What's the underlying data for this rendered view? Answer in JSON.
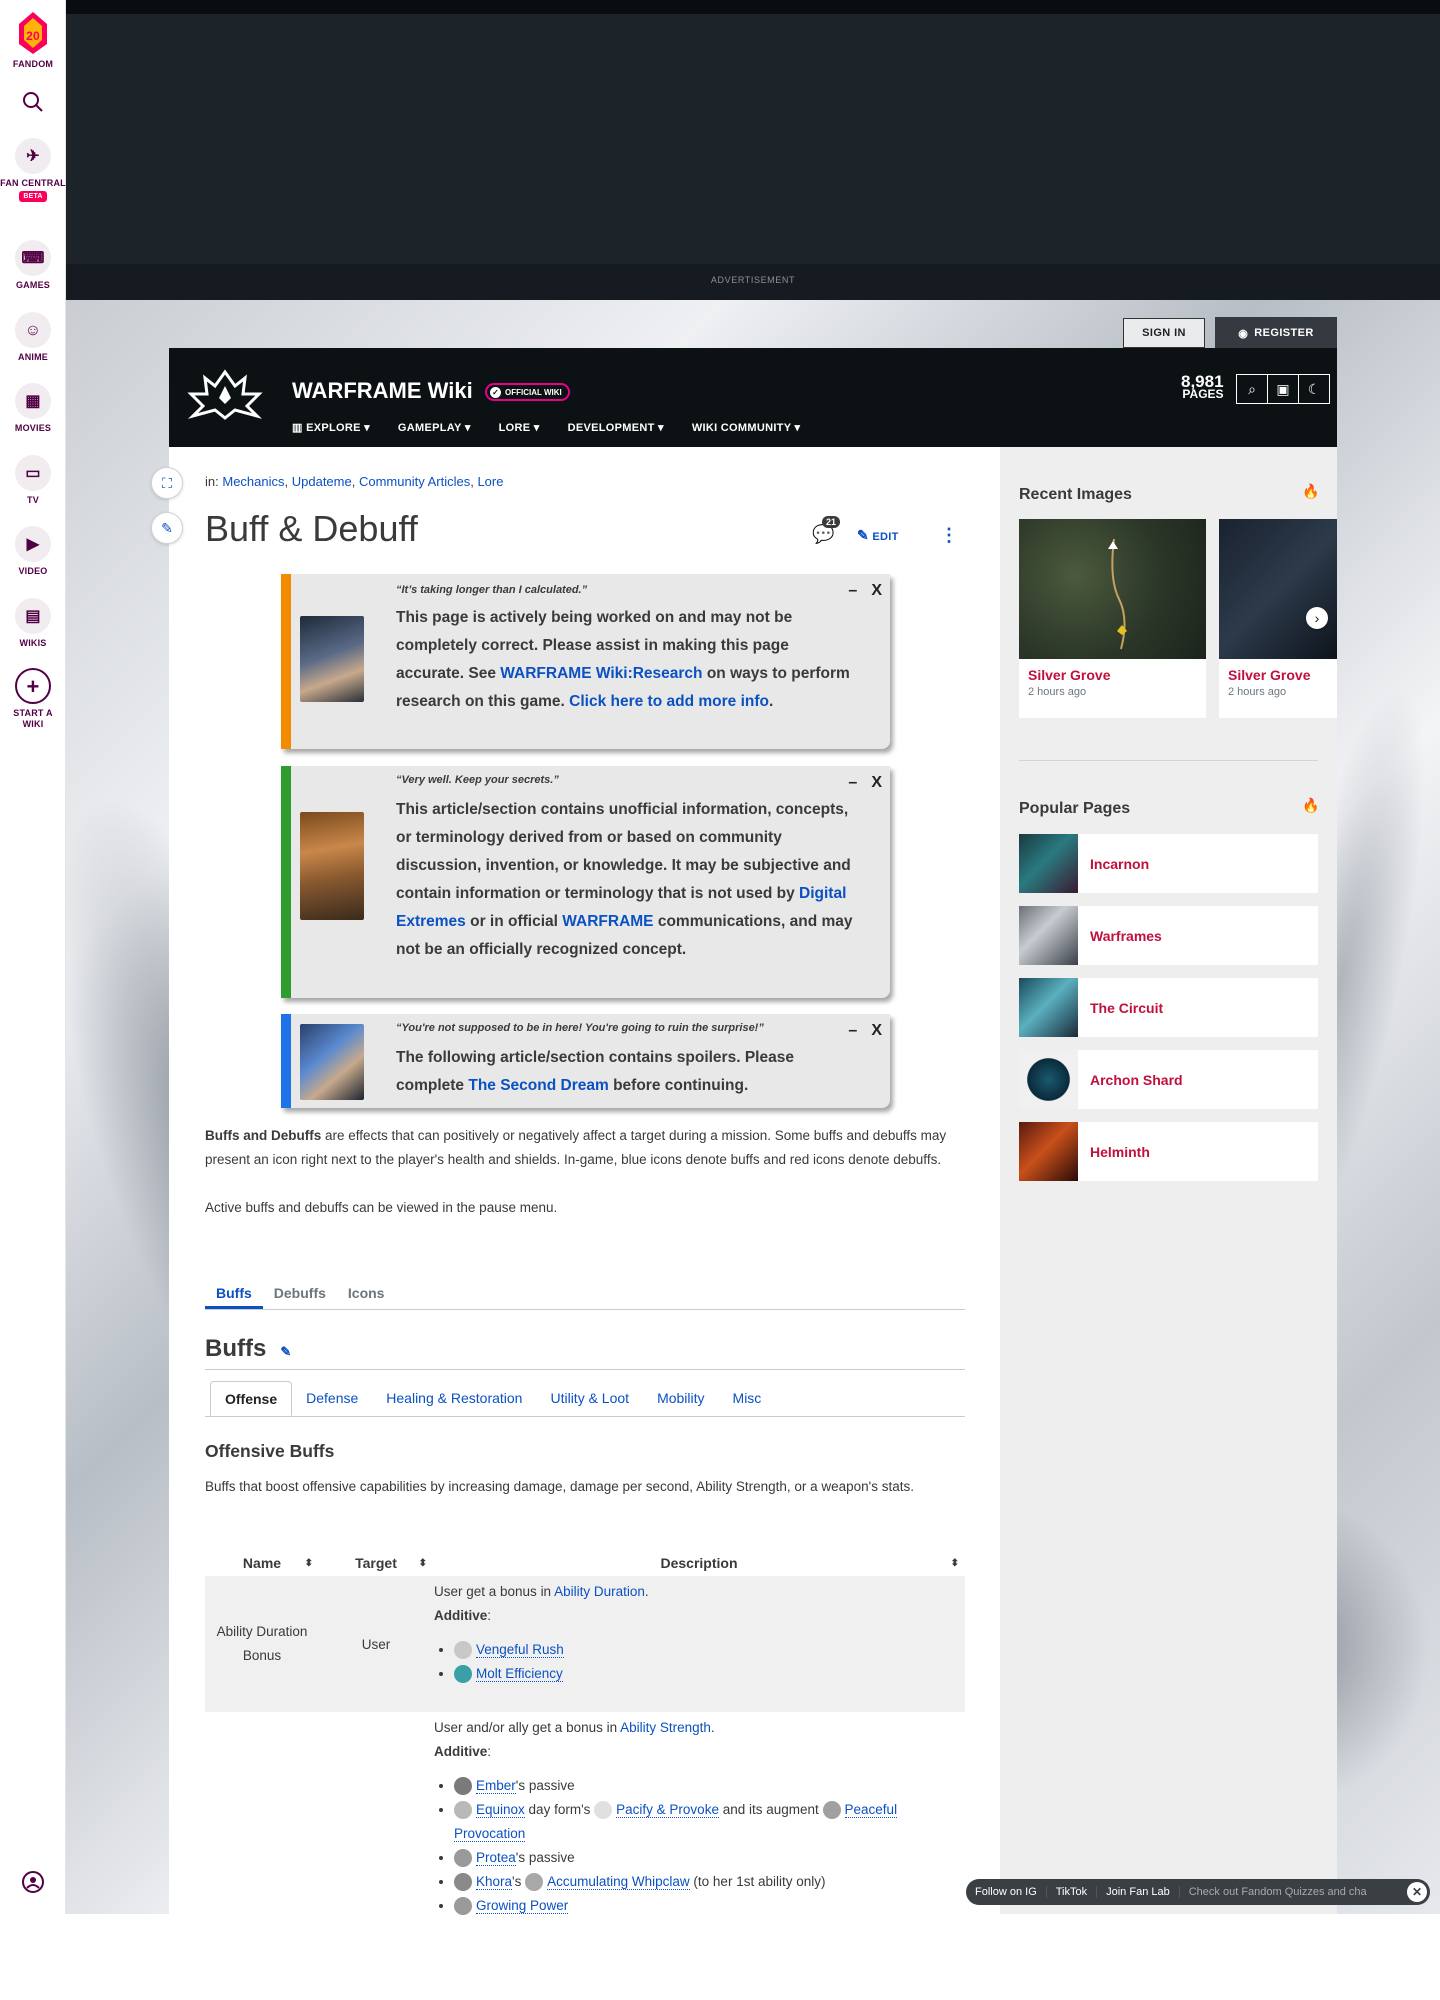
{
  "rail": {
    "fandom_badge": "20",
    "fandom": "FANDOM",
    "fan_central": "FAN CENTRAL",
    "beta": "BETA",
    "games": "GAMES",
    "anime": "ANIME",
    "movies": "MOVIES",
    "tv": "TV",
    "video": "VIDEO",
    "wikis": "WIKIS",
    "start_wiki": "START A WIKI"
  },
  "ad": {
    "label": "ADVERTISEMENT"
  },
  "auth": {
    "signin": "SIGN IN",
    "register": "REGISTER"
  },
  "wiki": {
    "title": "WARFRAME Wiki",
    "official": "OFFICIAL WIKI",
    "nav": [
      "EXPLORE",
      "GAMEPLAY",
      "LORE",
      "DEVELOPMENT",
      "WIKI COMMUNITY"
    ],
    "pages_count": "8,981",
    "pages_label": "PAGES"
  },
  "article": {
    "cats_prefix": "in:",
    "categories": [
      "Mechanics",
      "Updateme",
      "Community Articles",
      "Lore"
    ],
    "title": "Buff & Debuff",
    "comments": "21",
    "edit": "EDIT"
  },
  "notices": [
    {
      "quote": "“It’s taking longer than I calculated.”",
      "text1": "This page is actively being worked on and may not be completely correct. Please assist in making this page accurate. See ",
      "link1": "WARFRAME Wiki:Research",
      "text2": " on ways to perform research on this game. ",
      "link2": "Click here to add more info",
      "text3": ".",
      "color": "#f28b00"
    },
    {
      "quote": "“Very well. Keep your secrets.”",
      "text1": "This article/section contains unofficial information, concepts, or terminology derived from or based on community discussion, invention, or knowledge. It may be subjective and contain information or terminology that is not used by ",
      "link1": "Digital Extremes",
      "text2": " or in official ",
      "link2": "WARFRAME",
      "text3": " communications, and may not be an officially recognized concept.",
      "color": "#2e9c2e"
    },
    {
      "quote": "“You're not supposed to be in here! You're going to ruin the surprise!”",
      "text1": "The following article/section contains spoilers. Please complete ",
      "link1": "The Second Dream",
      "text2": " before continuing.",
      "color": "#1e73e8"
    }
  ],
  "intro": {
    "bold": "Buffs and Debuffs",
    "p1": " are effects that can positively or negatively affect a target during a mission. Some buffs and debuffs may present an icon right next to the player's health and shields. In-game, blue icons denote buffs and red icons denote debuffs.",
    "p2": "Active buffs and debuffs can be viewed in the pause menu."
  },
  "tabs": [
    "Buffs",
    "Debuffs",
    "Icons"
  ],
  "section_title": "Buffs",
  "subtabs": [
    "Offense",
    "Defense",
    "Healing & Restoration",
    "Utility & Loot",
    "Mobility",
    "Misc"
  ],
  "sub_title": "Offensive Buffs",
  "sub_desc": "Buffs that boost offensive capabilities by increasing damage, damage per second, Ability Strength, or a weapon's stats.",
  "table": {
    "headers": [
      "Name",
      "Target",
      "Description"
    ],
    "row1": {
      "name": "Ability Duration Bonus",
      "target": "User",
      "desc_pre": "User get a bonus in ",
      "desc_link": "Ability Duration",
      "desc_post": ".",
      "additive": "Additive",
      "items": [
        "Vengeful Rush",
        "Molt Efficiency"
      ]
    },
    "row2": {
      "desc_pre": "User and/or ally get a bonus in ",
      "desc_link": "Ability Strength",
      "desc_post": ".",
      "additive": "Additive",
      "i1_link": "Ember",
      "i1_text": "'s passive",
      "i2_link": "Equinox",
      "i2_text": " day form's ",
      "i2_link2": "Pacify & Provoke",
      "i2_text2": " and its augment ",
      "i2_link3": "Peaceful Provocation",
      "i3_link": "Protea",
      "i3_text": "'s passive",
      "i4_link": "Khora",
      "i4_text": "'s ",
      "i4_link2": "Accumulating Whipclaw",
      "i4_text2": " (to her 1st ability only)",
      "i5_link": "Growing Power"
    }
  },
  "recent": {
    "title": "Recent Images",
    "images": [
      {
        "label": "Silver Grove",
        "time": "2 hours ago"
      },
      {
        "label": "Silver Grove",
        "time": "2 hours ago"
      }
    ]
  },
  "popular": {
    "title": "Popular Pages",
    "items": [
      "Incarnon",
      "Warframes",
      "The Circuit",
      "Archon Shard",
      "Helminth"
    ]
  },
  "footer": {
    "items": [
      "Follow on IG",
      "TikTok",
      "Join Fan Lab"
    ],
    "ticker": "Check out Fandom Quizzes and cha"
  }
}
